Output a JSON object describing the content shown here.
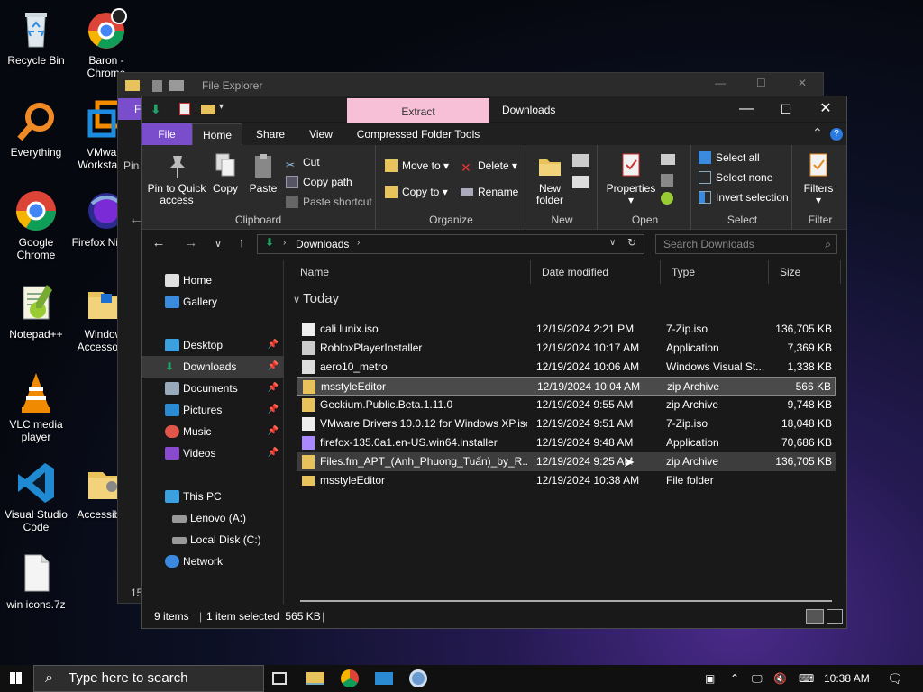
{
  "desktop": {
    "icons": [
      {
        "label": "Recycle Bin"
      },
      {
        "label": "Baron - Chrome"
      },
      {
        "label": "Everything"
      },
      {
        "label": "VMware Workstation"
      },
      {
        "label": "Google Chrome"
      },
      {
        "label": "Firefox Nightly"
      },
      {
        "label": "Notepad++"
      },
      {
        "label": "Windows Accessories"
      },
      {
        "label": "VLC media player"
      },
      {
        "label": "Visual Studio Code"
      },
      {
        "label": "Accessibility"
      },
      {
        "label": "win icons.7z"
      }
    ]
  },
  "back_window": {
    "title": "File Explorer",
    "partial_tab": "F",
    "partial_pin": "Pin",
    "partial_status": "15"
  },
  "window": {
    "context_tab": "Extract",
    "title": "Downloads",
    "tabs": [
      "File",
      "Home",
      "Share",
      "View",
      "Compressed Folder Tools"
    ],
    "ribbon": {
      "clipboard": {
        "pin": "Pin to Quick access",
        "copy": "Copy",
        "paste": "Paste",
        "cut": "Cut",
        "copy_path": "Copy path",
        "paste_shortcut": "Paste shortcut",
        "label": "Clipboard"
      },
      "organize": {
        "move_to": "Move to",
        "copy_to": "Copy to",
        "delete": "Delete",
        "rename": "Rename",
        "label": "Organize"
      },
      "new": {
        "new_folder": "New folder",
        "label": "New"
      },
      "open": {
        "properties": "Properties",
        "label": "Open"
      },
      "select": {
        "select_all": "Select all",
        "select_none": "Select none",
        "invert": "Invert selection",
        "label": "Select"
      },
      "filter": {
        "filters": "Filters",
        "label": "Filter"
      }
    },
    "address": {
      "path": "Downloads",
      "search_placeholder": "Search Downloads"
    },
    "nav": [
      {
        "label": "Home",
        "pinned": false
      },
      {
        "label": "Gallery",
        "pinned": false
      },
      {
        "label": "Desktop",
        "pinned": true
      },
      {
        "label": "Downloads",
        "pinned": true
      },
      {
        "label": "Documents",
        "pinned": true
      },
      {
        "label": "Pictures",
        "pinned": true
      },
      {
        "label": "Music",
        "pinned": true
      },
      {
        "label": "Videos",
        "pinned": true
      },
      {
        "label": "This PC",
        "pinned": false
      },
      {
        "label": "Lenovo (A:)",
        "pinned": false
      },
      {
        "label": "Local Disk (C:)",
        "pinned": false
      },
      {
        "label": "Network",
        "pinned": false
      }
    ],
    "columns": {
      "name": "Name",
      "date": "Date modified",
      "type": "Type",
      "size": "Size"
    },
    "group": "Today",
    "files": [
      {
        "name": "cali lunix.iso",
        "date": "12/19/2024 2:21 PM",
        "type": "7-Zip.iso",
        "size": "136,705 KB"
      },
      {
        "name": "RobloxPlayerInstaller",
        "date": "12/19/2024 10:17 AM",
        "type": "Application",
        "size": "7,369 KB"
      },
      {
        "name": "aero10_metro",
        "date": "12/19/2024 10:06 AM",
        "type": "Windows Visual St...",
        "size": "1,338 KB"
      },
      {
        "name": "msstyleEditor",
        "date": "12/19/2024 10:04 AM",
        "type": "zip Archive",
        "size": "566 KB"
      },
      {
        "name": "Geckium.Public.Beta.1.11.0",
        "date": "12/19/2024 9:55 AM",
        "type": "zip Archive",
        "size": "9,748 KB"
      },
      {
        "name": "VMware Drivers 10.0.12 for Windows XP.iso",
        "date": "12/19/2024 9:51 AM",
        "type": "7-Zip.iso",
        "size": "18,048 KB"
      },
      {
        "name": "firefox-135.0a1.en-US.win64.installer",
        "date": "12/19/2024 9:48 AM",
        "type": "Application",
        "size": "70,686 KB"
      },
      {
        "name": "Files.fm_APT_(Anh_Phuong_Tuấn)_by_R...",
        "date": "12/19/2024 9:25 AM",
        "type": "zip Archive",
        "size": "136,705 KB"
      },
      {
        "name": "msstyleEditor",
        "date": "12/19/2024 10:38 AM",
        "type": "File folder",
        "size": ""
      }
    ],
    "status": {
      "count": "9 items",
      "selected": "1 item selected  565 KB"
    }
  },
  "taskbar": {
    "search_placeholder": "Type here to search",
    "time": "10:38 AM"
  }
}
